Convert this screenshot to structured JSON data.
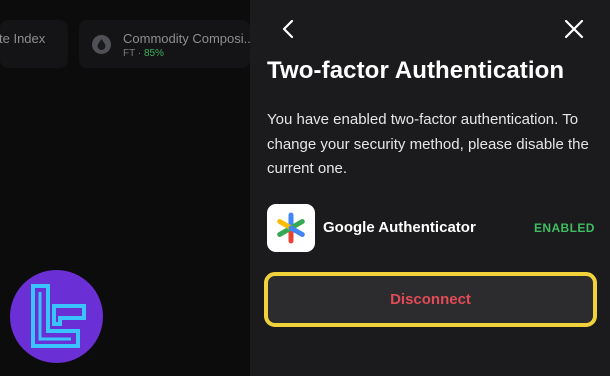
{
  "background": {
    "cards": [
      {
        "title": "te Index",
        "subtitle": ""
      },
      {
        "title": "Commodity Composi...",
        "subtitle_prefix": "FT · ",
        "subtitle_value": "85%",
        "icon": "drop-icon"
      }
    ],
    "logo": "brand-logo"
  },
  "panel": {
    "back_icon": "chevron-left-icon",
    "close_icon": "close-icon",
    "title": "Two-factor Authentication",
    "description": "You have enabled two-factor authentication. To change your security method, please disable the current one.",
    "method": {
      "icon": "google-authenticator-icon",
      "name": "Google Authenticator",
      "status": "ENABLED",
      "status_color": "#3fbd62"
    },
    "disconnect_label": "Disconnect",
    "disconnect_color": "#e24b55",
    "highlight_color": "#f2d23a"
  }
}
